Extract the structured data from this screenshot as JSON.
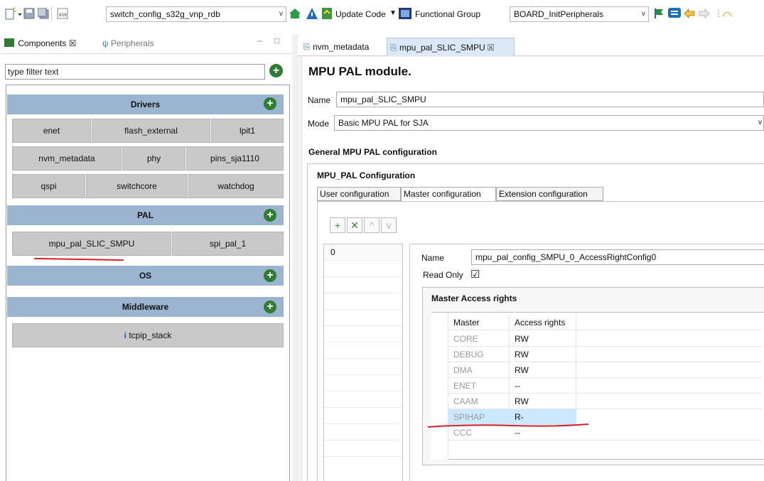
{
  "toolbar": {
    "config_combo": "switch_config_s32g_vnp_rdb",
    "update_code": "Update Code",
    "functional_group_label": "Functional Group",
    "functional_group_value": "BOARD_InitPeripherals"
  },
  "left_panel": {
    "tabs": {
      "components": "Components ☒",
      "peripherals": "Peripherals"
    },
    "filter_placeholder": "type filter text",
    "categories": {
      "drivers": "Drivers",
      "pal": "PAL",
      "os": "OS",
      "middleware": "Middleware"
    },
    "drivers": [
      "enet",
      "flash_external",
      "lpit1",
      "nvm_metadata",
      "phy",
      "pins_sja1110",
      "qspi",
      "switchcore",
      "watchdog"
    ],
    "pal": [
      "mpu_pal_SLIC_SMPU",
      "spi_pal_1"
    ],
    "middleware": [
      "tcpip_stack"
    ]
  },
  "editor": {
    "tabs": {
      "nvm_metadata": "nvm_metadata",
      "mpu": "mpu_pal_SLIC_SMPU ☒"
    },
    "title": "MPU PAL module.",
    "name_label": "Name",
    "name_value": "mpu_pal_SLIC_SMPU",
    "mode_label": "Mode",
    "mode_value": "Basic MPU PAL for SJA",
    "general_section": "General MPU PAL configuration",
    "mpu_config_section": "MPU_PAL Configuration",
    "subtabs": {
      "user": "User configuration",
      "master": "Master configuration",
      "extension": "Extension configuration"
    },
    "list_items": [
      "0"
    ],
    "detail": {
      "name_label": "Name",
      "name_value": "mpu_pal_config_SMPU_0_AccessRightConfig0",
      "read_only_label": "Read Only",
      "read_only_checked": "☑"
    },
    "access_rights": {
      "section": "Master Access rights",
      "col_master": "Master",
      "col_rights": "Access rights",
      "rows": [
        {
          "master": "CORE",
          "rights": "RW"
        },
        {
          "master": "DEBUG",
          "rights": "RW"
        },
        {
          "master": "DMA",
          "rights": "RW"
        },
        {
          "master": "ENET",
          "rights": "--"
        },
        {
          "master": "CAAM",
          "rights": "RW"
        },
        {
          "master": "SPIHAP",
          "rights": "R-"
        },
        {
          "master": "CCC",
          "rights": "--"
        }
      ],
      "selected_row": "SPIHAP"
    }
  },
  "colors": {
    "category_bg": "#9bb4cf",
    "cell_bg": "#c9c9c9",
    "selected_row": "#cce8ff",
    "annotation": "#d4202a",
    "add_green": "#2e7d32"
  }
}
